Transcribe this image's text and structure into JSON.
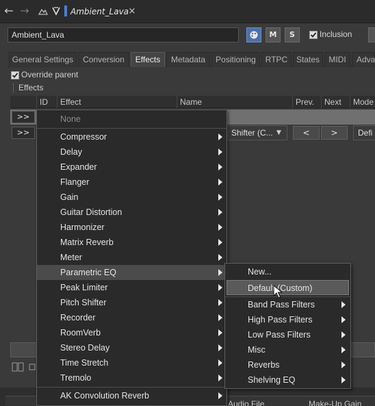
{
  "topbar": {
    "back_icon": "arrow-left-icon",
    "forward_icon": "arrow-right-icon",
    "doc_tab_title": "Ambient_Lava",
    "doc_tab_close": "×",
    "doc_tab_color": "#4a7fd0"
  },
  "object": {
    "name": "Ambient_Lava",
    "m_label": "M",
    "s_label": "S",
    "inclusion_label": "Inclusion"
  },
  "tabs": [
    {
      "label": "General Settings"
    },
    {
      "label": "Conversion"
    },
    {
      "label": "Effects"
    },
    {
      "label": "Metadata"
    },
    {
      "label": "Positioning"
    },
    {
      "label": "RTPC"
    },
    {
      "label": "States"
    },
    {
      "label": "MIDI"
    },
    {
      "label": "Adva"
    }
  ],
  "effects": {
    "override_label": "Override parent",
    "section_label": "Effects",
    "columns": [
      "ID",
      "Effect",
      "Name",
      "Prev.",
      "Next",
      "Mode"
    ],
    "row_button_label": ">>",
    "row2": {
      "effect_name": "Shifter (C...",
      "prev": "<",
      "next": ">",
      "mode": "Defi"
    }
  },
  "effect_menu": {
    "none_label": "None",
    "items": [
      "Compressor",
      "Delay",
      "Expander",
      "Flanger",
      "Gain",
      "Guitar Distortion",
      "Harmonizer",
      "Matrix Reverb",
      "Meter",
      "Parametric EQ",
      "Peak Limiter",
      "Pitch Shifter",
      "Recorder",
      "RoomVerb",
      "Stereo Delay",
      "Time Stretch",
      "Tremolo"
    ],
    "after_sep": [
      "AK Convolution Reverb"
    ],
    "highlighted": "Parametric EQ"
  },
  "preset_menu": {
    "new_label": "New...",
    "default_label": "Default (Custom)",
    "items": [
      "Band Pass Filters",
      "High Pass Filters",
      "Low Pass Filters",
      "Misc",
      "Reverbs",
      "Shelving EQ"
    ]
  },
  "bottom": {
    "audio_file_label": "Audio File",
    "makeup_gain_label": "Make-Up Gain"
  }
}
